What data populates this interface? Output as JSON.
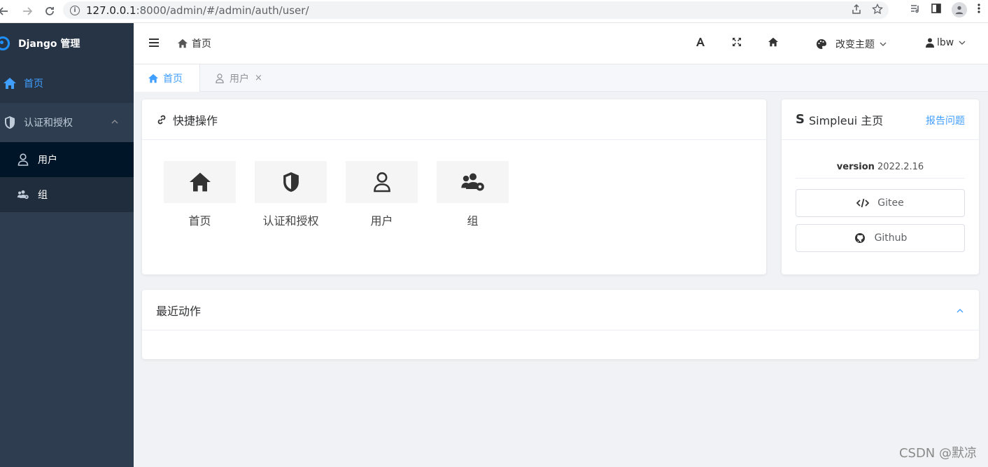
{
  "browser": {
    "url_host": "127.0.0.1",
    "url_path": ":8000/admin/#/admin/auth/user/"
  },
  "sidebar": {
    "logo_title": "Django 管理",
    "items": [
      {
        "label": "首页"
      },
      {
        "label": "认证和授权"
      }
    ],
    "sub_items": [
      {
        "label": "用户"
      },
      {
        "label": "组"
      }
    ]
  },
  "header": {
    "breadcrumb": "首页",
    "theme_label": "改变主题",
    "user_label": "lbw"
  },
  "tabs": [
    {
      "label": "首页"
    },
    {
      "label": "用户",
      "close": "×"
    }
  ],
  "quick": {
    "title": "快捷操作",
    "items": [
      {
        "label": "首页"
      },
      {
        "label": "认证和授权"
      },
      {
        "label": "用户"
      },
      {
        "label": "组"
      }
    ]
  },
  "simpleui": {
    "title": "Simpleui 主页",
    "report": "报告问题",
    "version_key": "version",
    "version_value": "2022.2.16",
    "buttons": [
      {
        "label": "Gitee"
      },
      {
        "label": "Github"
      }
    ]
  },
  "recent": {
    "title": "最近动作"
  },
  "watermark": "CSDN @默凉",
  "colors": {
    "accent": "#409eff",
    "sidebar": "#2e3e50",
    "sidebar_dark": "#001528"
  }
}
